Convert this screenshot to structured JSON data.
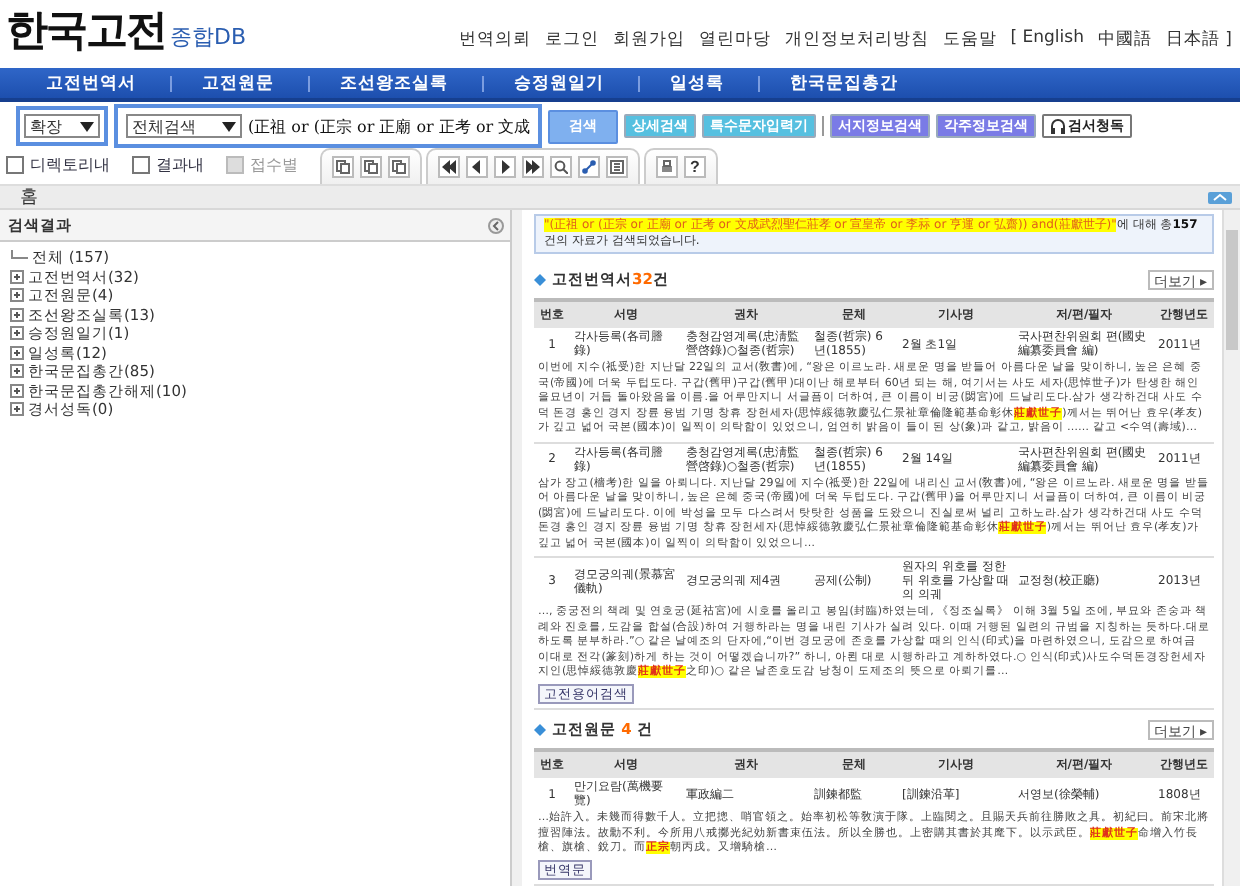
{
  "header": {
    "logo": "한국고전",
    "logo_sub": "종합DB",
    "links": [
      "번역의뢰",
      "로그인",
      "회원가입",
      "열린마당",
      "개인정보처리방침",
      "도움말"
    ],
    "languages": [
      "[ English",
      "中國語",
      "日本語 ]"
    ]
  },
  "nav": {
    "items": [
      "고전번역서",
      "고전원문",
      "조선왕조실록",
      "승정원일기",
      "일성록",
      "한국문집총간"
    ]
  },
  "search": {
    "scope": "확장",
    "field": "전체검색",
    "value": "(正祖 or (正宗 or 正廟 or 正考 or 文成",
    "buttons": [
      {
        "label": "검색",
        "kind": "main"
      },
      {
        "label": "상세검색",
        "kind": "cyan"
      },
      {
        "label": "특수문자입력기",
        "kind": "cyan"
      },
      {
        "label": "서지정보검색",
        "kind": "violet"
      },
      {
        "label": "각주정보검색",
        "kind": "violet"
      },
      {
        "label": "검서청독",
        "kind": "audio"
      }
    ]
  },
  "toolbar": {
    "checks": [
      {
        "label": "디렉토리내",
        "checked": false,
        "disabled": false
      },
      {
        "label": "결과내",
        "checked": false,
        "disabled": false
      },
      {
        "label": "접수별",
        "checked": false,
        "disabled": true
      }
    ],
    "help": "?"
  },
  "breadcrumb": "홈",
  "sidebar": {
    "title": "검색결과",
    "tree": [
      {
        "label": "전체 (157)",
        "expanded": true,
        "children": [
          {
            "label": "고전번역서(32)",
            "expanded": false
          },
          {
            "label": "고전원문(4)",
            "expanded": false
          },
          {
            "label": "조선왕조실록(13)",
            "expanded": false
          },
          {
            "label": "승정원일기(1)",
            "expanded": false
          },
          {
            "label": "일성록(12)",
            "expanded": false
          },
          {
            "label": "한국문집총간(85)",
            "expanded": false
          },
          {
            "label": "한국문집총간해제(10)",
            "expanded": false
          },
          {
            "label": "경서성독(0)",
            "expanded": false
          }
        ]
      }
    ]
  },
  "query_bar": {
    "query": "\"(正祖 or (正宗 or 正廟 or 正考 or 文成武烈聖仁莊孝 or 宣皇帝 or 李祘 or 亨運 or 弘齋)) and(莊獻世子)\"",
    "message": "에 대해 총**157**건의 자료가 검색되었습니다."
  },
  "sections": [
    {
      "title": "고전번역서**32**건",
      "more": "더보기 ▸",
      "columns": [
        "번호",
        "서명",
        "권차",
        "문체",
        "기사명",
        "저/편/필자",
        "간행년도"
      ],
      "rows": [
        {
          "cells": [
            "1",
            "각사등록(各司謄錄)",
            "충청감영계록(忠淸監營啓錄)○철종(哲宗)",
            "철종(哲宗) 6년(1855)",
            "2월 초1일",
            "국사편찬위원회 편(國史編纂委員會 編)",
            "2011년"
          ],
          "snippet": "이번에 지수(祗受)한 지난달 22일의 교서(敎書)에, “왕은 이르노라. 새로운 명을 받들어 아름다운 날을 맞이하니, 높은 은혜 중국(帝國)에 더욱 두텁도다. 구갑(舊甲)구갑(舊甲)대이난 해로부터 60년 되는 해, 여기서는 사도 세자(思悼世子)가 탄생한 해인 을묘년이 거듭 돌아왔음을 이름.을 어루만지니 서글픔이 더하여, 큰 이름이 비궁(閟宮)에 드날리도다.삼가 생각하건대 사도 수덕 돈경 홍인 경지 장륜 융범 기명 창휴 장헌세자(思悼綏德敦慶弘仁景祉章倫隆範基命彰休**莊獻世子**)께서는 뛰어난 효우(孝友)가 깊고 넓어 국본(國本)이 일찍이 의탁함이 있었으니, 엄연히 밝음이 들이 된 상(象)과 같고, 밝음이 …… 같고 <수역(壽域)…"
        },
        {
          "cells": [
            "2",
            "각사등록(各司謄錄)",
            "충청감영계록(忠淸監營啓錄)○철종(哲宗)",
            "철종(哲宗) 6년(1855)",
            "2월 14일",
            "국사편찬위원회 편(國史編纂委員會 編)",
            "2011년"
          ],
          "snippet": "삼가 장고(檣考)한 일을 아뢰니다. 지난달 29일에 지수(祗受)한 22일에 내리신 교서(敎書)에, “왕은 이르노라. 새로운 명을 받들어 아름다운 날을 맞이하니, 높은 은혜 중국(帝國)에 더욱 두텁도다. 구갑(舊甲)을 어루만지니 서글픔이 더하여, 큰 이름이 비궁(閟宮)에 드날리도다. 이에 박성을 모두 다스려서 탓탓한 성품을 도왔으니 진실로써 널리 고하노라.삼가 생각하건대 사도 수덕 돈경 홍인 경지 장륜 융범 기명 창휴 장헌세자(思悼綏德敦慶弘仁景祉章倫隆範基命彰休**莊獻世子**)께서는 뛰어난 효우(孝友)가 깊고 넓어 국본(國本)이 일찍이 의탁함이 있었으니…"
        },
        {
          "cells": [
            "3",
            "경모궁의궤(景慕宮儀軌)",
            "경모궁의궤 제4권",
            "공제(公制)",
            "원자의 위호를 정한 뒤 위호를 가상할 때의 의궤",
            "교정청(校正廳)",
            "2013년"
          ],
          "snippet": "…, 중궁전의 책례 및 연호궁(延祜宮)에 시호를 올리고 봉임(封臨)하였는데, 《정조실록》 이해 3월 5일 조에, 부묘와 존숭과 책례와 진호를, 도감을 합설(合設)하여 거행하라는 명을 내린 기사가 실려 있다. 이때 거행된 일련의 규범을 지칭하는 듯하다.대로 하도록 분부하라.”○ 같은 날예조의 단자에,“이번 경모궁에 존호를 가상할 때의 인식(印式)을 마련하였으니, 도감으로 하여금 이대로 전각(篆刻)하게 하는 것이 어떻겠습니까?” 하니, 아뢴 대로 시행하라고 계하하였다.○ 인식(印式)사도수덕돈경장헌세자지인(思悼綏德敦慶**莊獻世子**之印)○ 같은 날존호도감 낭청이 도제조의 뜻으로 아뢰기를…",
          "action": "고전용어검색"
        }
      ]
    },
    {
      "title": "고전원문 **4** 건",
      "more": "더보기 ▸",
      "columns": [
        "번호",
        "서명",
        "권차",
        "문체",
        "기사명",
        "저/편/필자",
        "간행년도"
      ],
      "rows": [
        {
          "cells": [
            "1",
            "만기요람(萬機要覽)",
            "軍政編二",
            "訓鍊都監",
            "[訓鍊沿革]",
            "서영보(徐榮輔)",
            "1808년"
          ],
          "snippet": "…始許入。未幾而得數千人。立把摠、哨官領之。始率初松等敎演于隊。上臨閱之。且賜天兵前往勝敗之具。初紀曰。前宋北將擅習陣法。故勳不利。今所用八戒擲光紀効新書束伍法。所以全勝也。上密購其書於其麾下。以示武臣。**莊獻世子**命增入竹長槍、旗槍、銳刀。而**正宗**朝丙戌。又增騎槍…",
          "action": "번역문"
        }
      ]
    }
  ]
}
